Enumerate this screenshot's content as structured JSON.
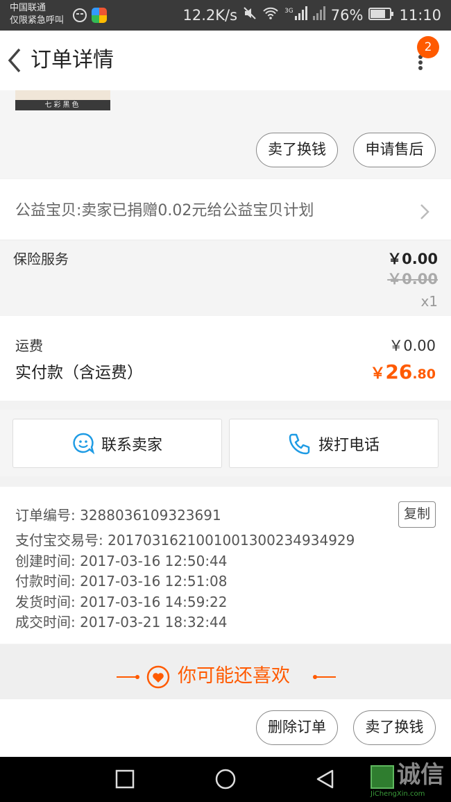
{
  "status_bar": {
    "carrier_line1": "中国联通",
    "carrier_line2": "仅限紧急呼叫",
    "net_speed": "12.2K/s",
    "network_badge": "3G",
    "battery": "76%",
    "time": "11:10"
  },
  "navbar": {
    "title": "订单详情",
    "badge_count": "2"
  },
  "product": {
    "thumb_caption": "七彩黑色",
    "buttons": [
      "卖了换钱",
      "申请售后"
    ]
  },
  "charity": {
    "text": "公益宝贝:卖家已捐赠0.02元给公益宝贝计划"
  },
  "insurance": {
    "label": "保险服务",
    "price": "￥0.00",
    "original_price": "￥0.00",
    "quantity": "x1"
  },
  "totals": {
    "shipping_label": "运费",
    "shipping_value": "￥0.00",
    "paid_label": "实付款（含运费）",
    "paid_currency": "￥",
    "paid_int": "26",
    "paid_dec": ".80"
  },
  "contact": {
    "seller_label": "联系卖家",
    "call_label": "拨打电话"
  },
  "order_info": {
    "order_no": "订单编号: 3288036109323691",
    "copy_label": "复制",
    "alipay_no": "支付宝交易号: 2017031621001001300234934929",
    "created": "创建时间: 2017-03-16 12:50:44",
    "paid": "付款时间: 2017-03-16 12:51:08",
    "shipped": "发货时间: 2017-03-16 14:59:22",
    "completed": "成交时间: 2017-03-21 18:32:44"
  },
  "recommend": {
    "title": "你可能还喜欢"
  },
  "bottom_actions": {
    "delete_label": "删除订单",
    "sell_label": "卖了换钱"
  },
  "watermark": {
    "text": "诚信",
    "sub": "JiChengXin.com"
  },
  "colors": {
    "accent_orange": "#ff5a00",
    "icon_blue": "#1e9be4"
  },
  "icons": [
    "back-arrow-icon",
    "more-vertical-icon",
    "smile-chat-icon",
    "phone-icon",
    "heart-icon",
    "square-nav-icon",
    "circle-nav-icon",
    "triangle-back-nav-icon"
  ]
}
